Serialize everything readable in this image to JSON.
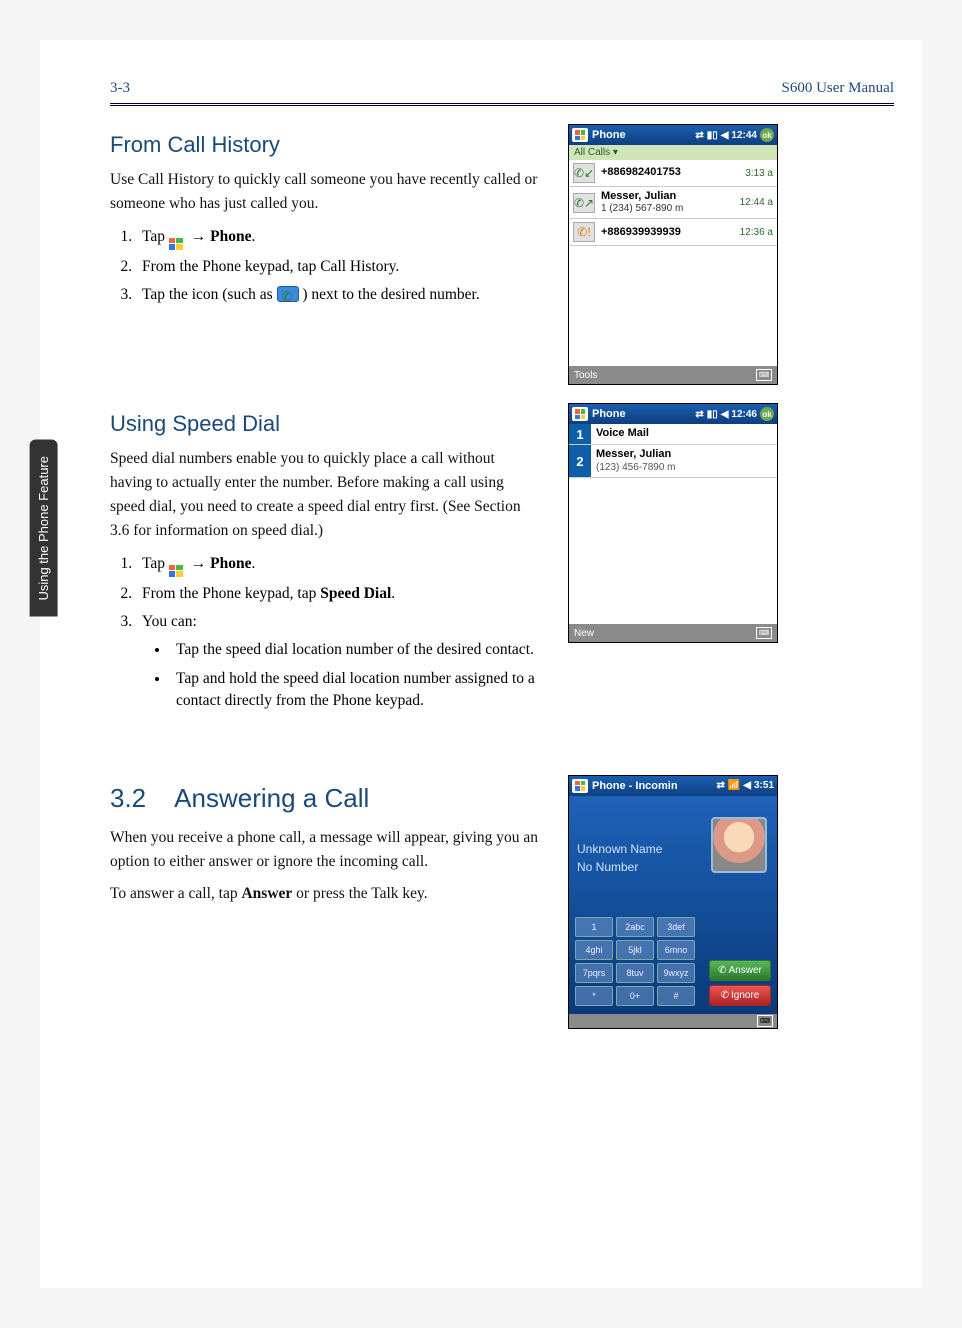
{
  "header": {
    "page_number": "3-3",
    "manual_title": "S600 User Manual"
  },
  "side_tab": "Using the Phone Feature",
  "section1": {
    "title": "From Call History",
    "intro": "Use Call History to quickly call someone you have recently called or someone who has just called you.",
    "steps": {
      "s1a": "Tap ",
      "s1b": " → ",
      "s1c": "Phone",
      "s1d": ".",
      "s2": "From the Phone keypad, tap Call History.",
      "s3a": "Tap the icon (such as ",
      "s3b": " ) next to the desired number."
    }
  },
  "shot1": {
    "title": "Phone",
    "clock": "12:44",
    "ok": "ok",
    "subbar": "All Calls ▾",
    "rows": [
      {
        "icon": "↙",
        "iconclass": "green",
        "main": "+886982401753",
        "sub": "",
        "time": "3:13 a"
      },
      {
        "icon": "↗",
        "iconclass": "green",
        "main": "Messer, Julian",
        "sub": "1 (234) 567-890 m",
        "time": "12:44 a"
      },
      {
        "icon": "!",
        "iconclass": "orange",
        "main": "+886939939939",
        "sub": "",
        "time": "12:36 a"
      }
    ],
    "footer": "Tools"
  },
  "section2": {
    "title": "Using Speed Dial",
    "intro": "Speed dial numbers enable you to quickly place a call without having to actually enter the number. Before making a call using speed dial, you need to create a speed dial entry first. (See Section 3.6 for information on speed dial.)",
    "steps": {
      "s1a": "Tap ",
      "s1b": " → ",
      "s1c": "Phone",
      "s1d": ".",
      "s2a": "From the Phone keypad, tap ",
      "s2b": "Speed Dial",
      "s2c": ".",
      "s3": "You can:",
      "b1": "Tap the speed dial location number of the desired contact.",
      "b2": "Tap and hold the speed dial location number assigned to a contact directly from the Phone keypad."
    }
  },
  "shot2": {
    "title": "Phone",
    "clock": "12:46",
    "ok": "ok",
    "rows": [
      {
        "num": "1",
        "main": "Voice Mail",
        "sub": ""
      },
      {
        "num": "2",
        "main": "Messer, Julian",
        "sub": "(123) 456-7890 m"
      }
    ],
    "footer": "New"
  },
  "section3": {
    "num": "3.2",
    "title": "Answering a Call",
    "p1": "When you receive a phone call, a message will appear, giving you an option to either answer or ignore the incoming call.",
    "p2a": "To answer a call, tap ",
    "p2b": "Answer",
    "p2c": " or press the Talk key."
  },
  "shot3": {
    "title": "Phone - Incomin",
    "clock": "3:51",
    "caller_name": "Unknown Name",
    "caller_num": "No Number",
    "keys": [
      "1",
      "2abc",
      "3def",
      "4ghi",
      "5jkl",
      "6mno",
      "7pqrs",
      "8tuv",
      "9wxyz",
      "*",
      "0+",
      "#"
    ],
    "answer": "Answer",
    "ignore": "Ignore"
  }
}
